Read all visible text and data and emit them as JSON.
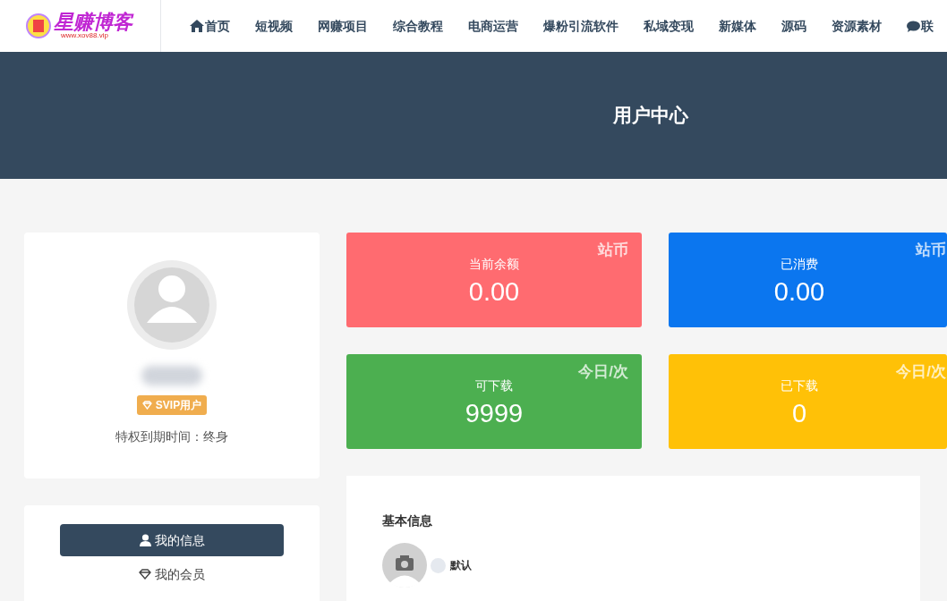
{
  "logo": {
    "name": "星赚博客",
    "url": "www.xov88.vip"
  },
  "nav": [
    {
      "label": "首页",
      "kind": "home"
    },
    {
      "label": "短视频"
    },
    {
      "label": "网赚项目"
    },
    {
      "label": "综合教程"
    },
    {
      "label": "电商运营"
    },
    {
      "label": "爆粉引流软件"
    },
    {
      "label": "私域变现"
    },
    {
      "label": "新媒体"
    },
    {
      "label": "源码"
    },
    {
      "label": "资源素材"
    },
    {
      "label": "联",
      "kind": "chat"
    }
  ],
  "banner": {
    "title": "用户中心"
  },
  "profile": {
    "badge": "SVIP用户",
    "expiry": "特权到期时间：终身"
  },
  "menu": [
    {
      "label": "我的信息",
      "kind": "user",
      "selected": true
    },
    {
      "label": "我的会员",
      "kind": "gem",
      "selected": false
    }
  ],
  "stats": [
    {
      "label": "当前余额",
      "value": "0.00",
      "unit": "站币",
      "color": "#ff6b70"
    },
    {
      "label": "已消费",
      "value": "0.00",
      "unit": "站币",
      "color": "#0b76ef"
    },
    {
      "label": "可下载",
      "value": "9999",
      "unit": "今日/次",
      "color": "#4caf50"
    },
    {
      "label": "已下载",
      "value": "0",
      "unit": "今日/次",
      "color": "#ffc107"
    }
  ],
  "basic_info": {
    "title": "基本信息",
    "avatar_option": "默认"
  }
}
